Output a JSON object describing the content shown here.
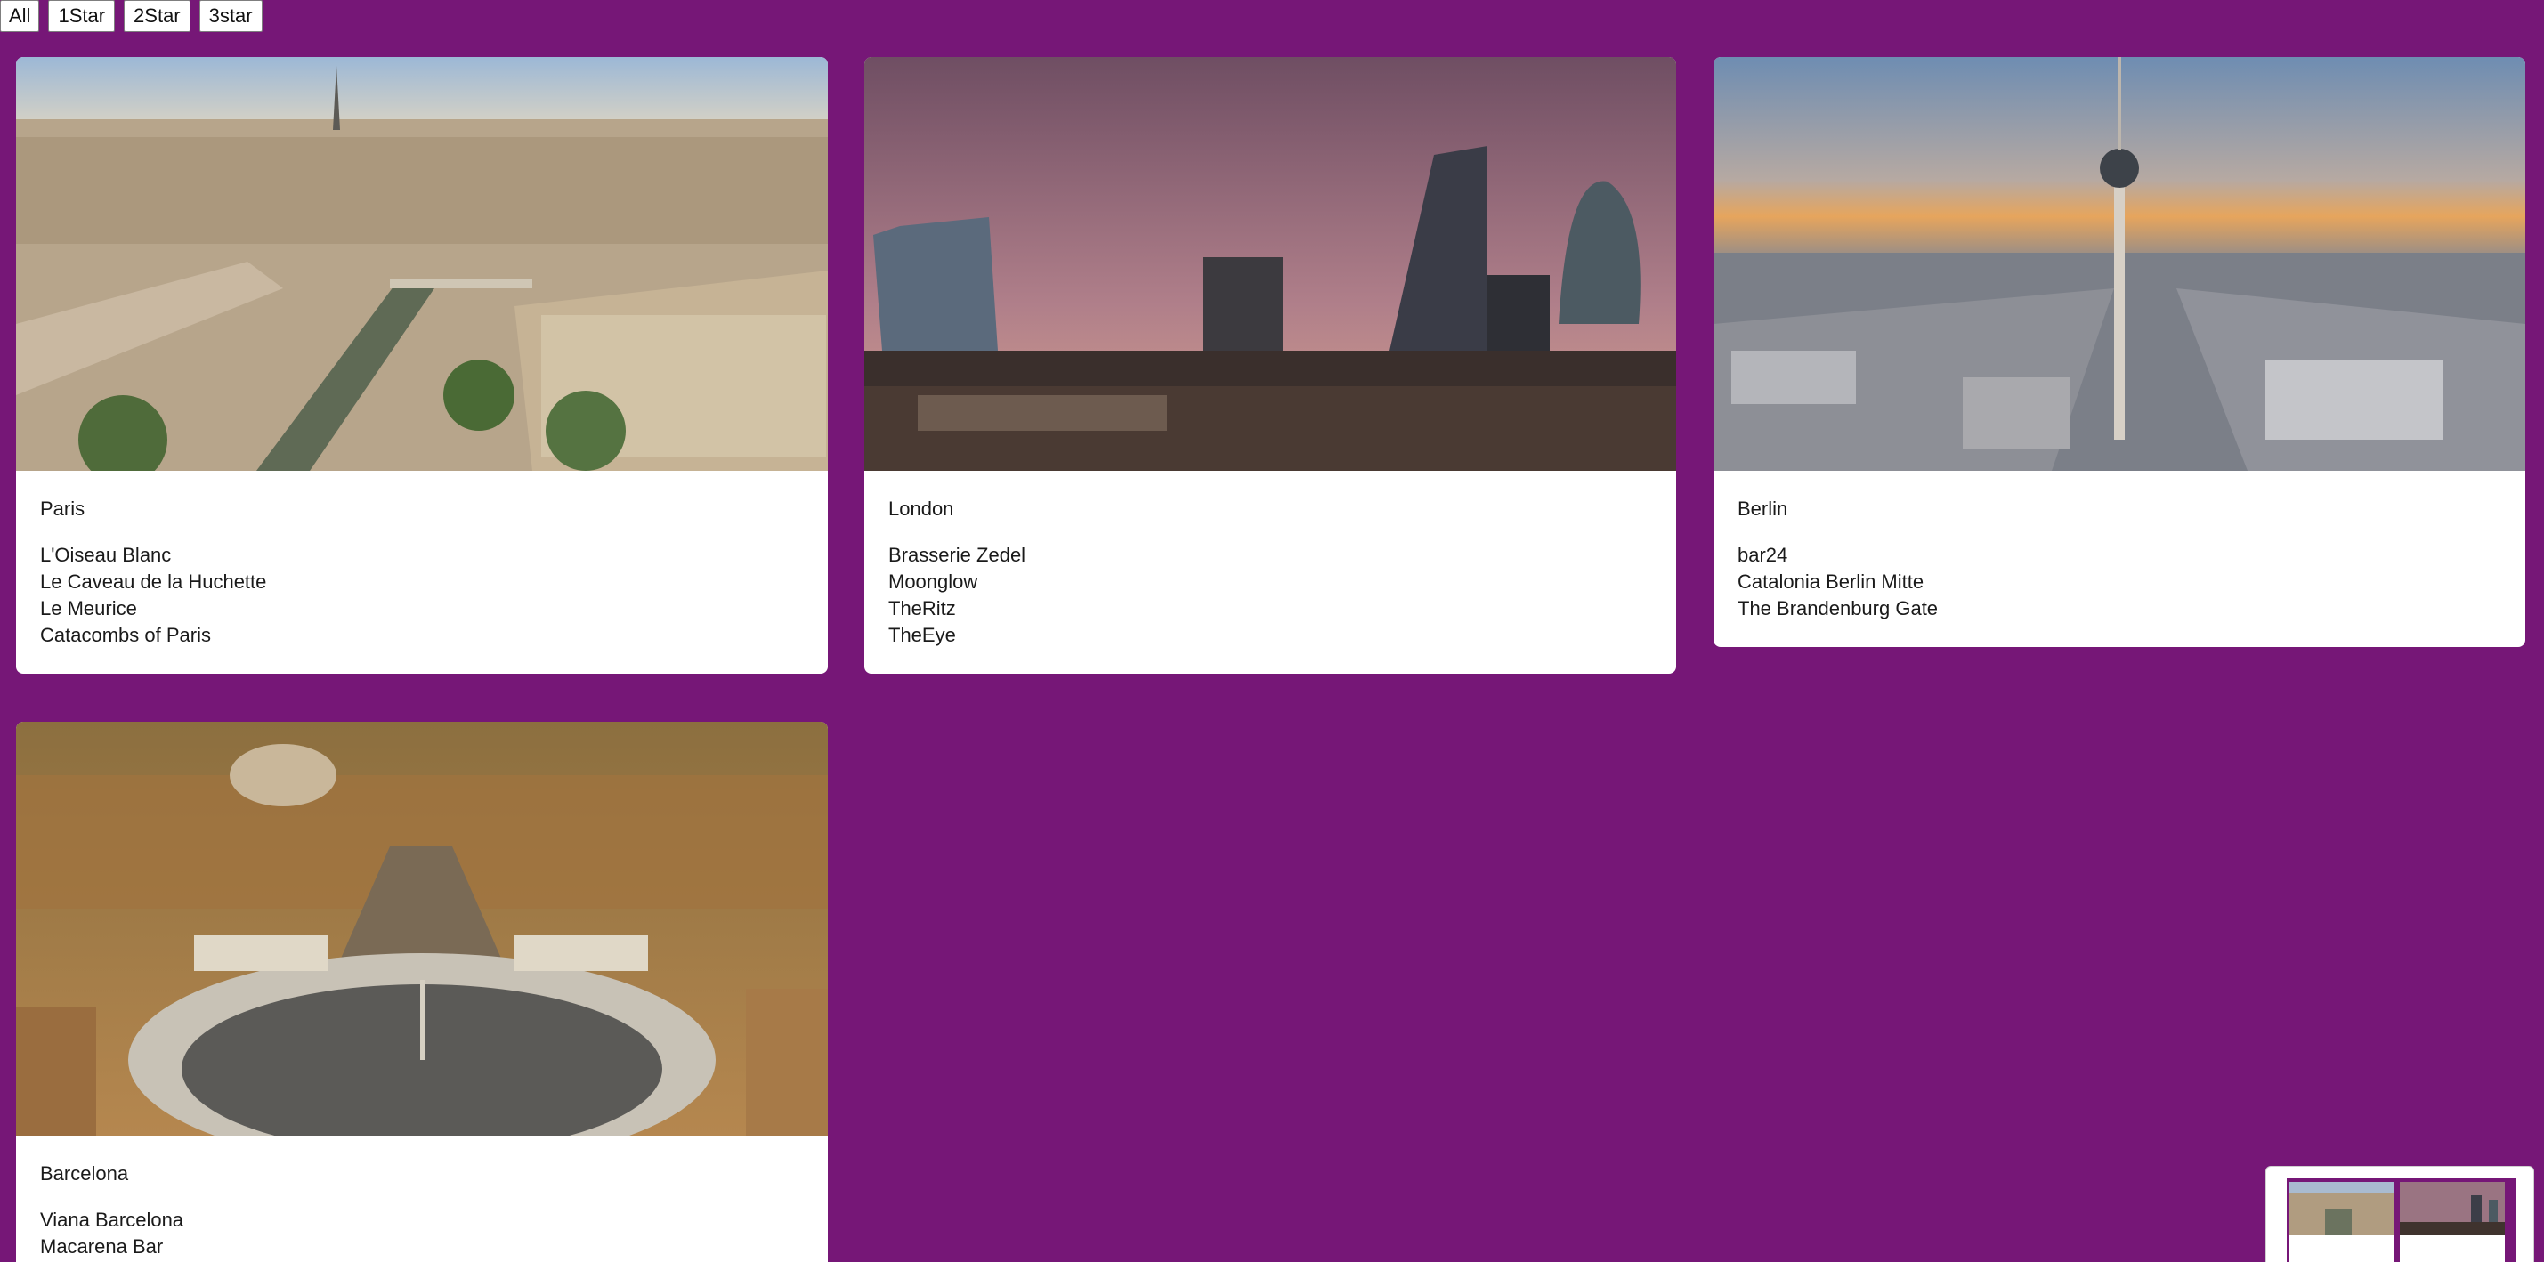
{
  "filters": [
    "All",
    "1Star",
    "2Star",
    "3star"
  ],
  "cities": [
    {
      "name": "Paris",
      "places": [
        "L'Oiseau Blanc",
        "Le Caveau de la Huchette",
        "Le Meurice",
        "Catacombs of Paris"
      ]
    },
    {
      "name": "London",
      "places": [
        "Brasserie Zedel",
        "Moonglow",
        "TheRitz",
        "TheEye"
      ]
    },
    {
      "name": "Berlin",
      "places": [
        "bar24",
        "Catalonia Berlin Mitte",
        "The Brandenburg Gate"
      ]
    },
    {
      "name": "Barcelona",
      "places": [
        "Viana Barcelona",
        "Macarena Bar"
      ]
    }
  ],
  "colors": {
    "background": "#761777",
    "card": "#ffffff",
    "text": "#1a1a1a"
  }
}
